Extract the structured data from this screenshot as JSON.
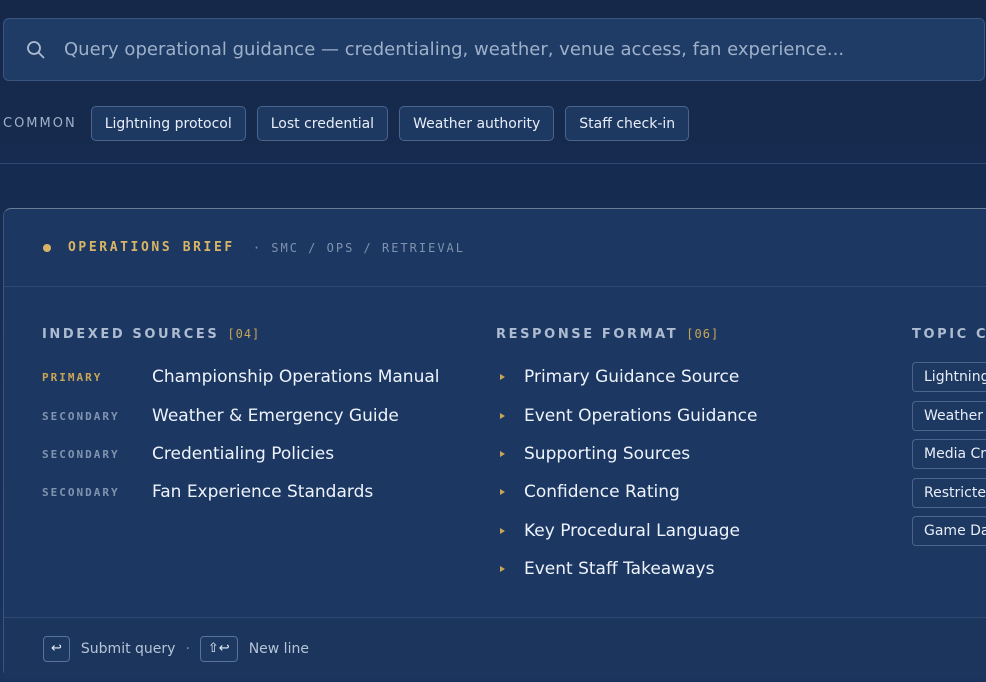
{
  "search": {
    "placeholder": "Query operational guidance — credentialing, weather, venue access, fan experience..."
  },
  "common": {
    "label": "COMMON",
    "chips": [
      "Lightning protocol",
      "Lost credential",
      "Weather authority",
      "Staff check-in"
    ]
  },
  "brief": {
    "title": "OPERATIONS BRIEF",
    "path": "· SMC / OPS / RETRIEVAL",
    "sources": {
      "heading": "INDEXED SOURCES",
      "count": "[04]",
      "items": [
        {
          "tier": "PRIMARY",
          "name": "Championship Operations Manual"
        },
        {
          "tier": "SECONDARY",
          "name": "Weather & Emergency Guide"
        },
        {
          "tier": "SECONDARY",
          "name": "Credentialing Policies"
        },
        {
          "tier": "SECONDARY",
          "name": "Fan Experience Standards"
        }
      ]
    },
    "format": {
      "heading": "RESPONSE FORMAT",
      "count": "[06]",
      "items": [
        "Primary Guidance Source",
        "Event Operations Guidance",
        "Supporting Sources",
        "Confidence Rating",
        "Key Procedural Language",
        "Event Staff Takeaways"
      ]
    },
    "topics": {
      "heading": "TOPIC CO",
      "items": [
        "Lightning",
        "Weather A",
        "Media Cre",
        "Restricted",
        "Game Day"
      ]
    },
    "footer": {
      "submit_key": "↩",
      "submit_label": "Submit query",
      "separator": "·",
      "newline_key": "⇧↩",
      "newline_label": "New line"
    }
  },
  "colors": {
    "background": "#15284a",
    "panel": "#1c3862",
    "accent_gold": "#d8b565",
    "text": "#eef3fb"
  }
}
